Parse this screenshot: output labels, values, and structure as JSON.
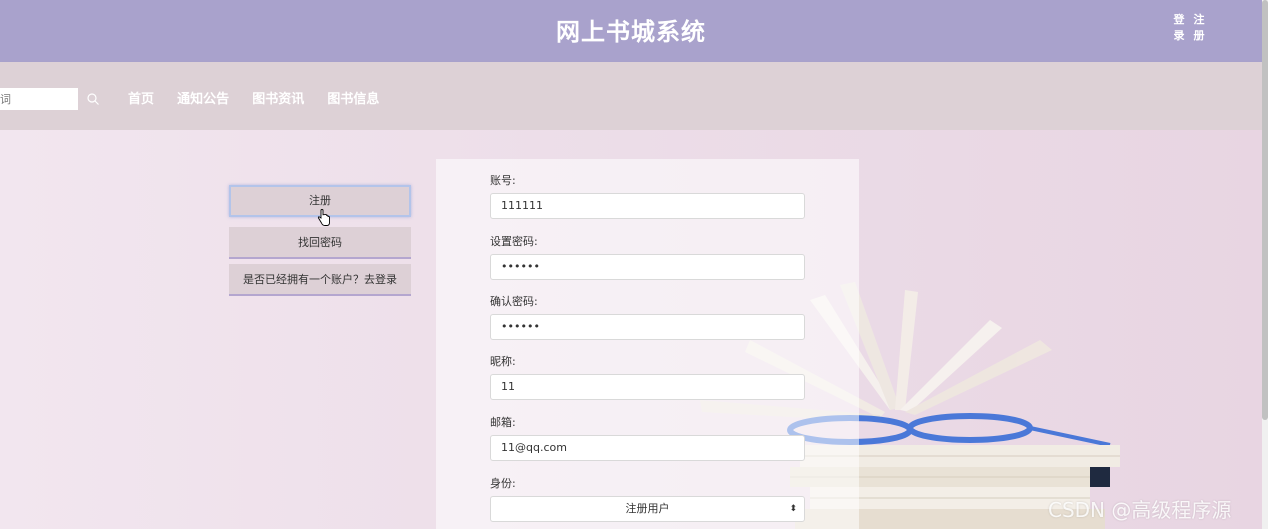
{
  "header": {
    "title": "网上书城系统",
    "login_link": [
      "登",
      "录"
    ],
    "register_link": [
      "注",
      "册"
    ]
  },
  "nav": {
    "search_value": "词",
    "links": [
      "首页",
      "通知公告",
      "图书资讯",
      "图书信息"
    ]
  },
  "side_buttons": {
    "register": "注册",
    "find_password": "找回密码",
    "go_login": "是否已经拥有一个账户？去登录"
  },
  "form": {
    "account_label": "账号:",
    "account_value": "111111",
    "password_label": "设置密码:",
    "password_value": "••••••",
    "confirm_label": "确认密码:",
    "confirm_value": "••••••",
    "nickname_label": "昵称:",
    "nickname_value": "11",
    "email_label": "邮箱:",
    "email_value": "11@qq.com",
    "role_label": "身份:",
    "role_value": "注册用户"
  },
  "watermark": "CSDN @高级程序源",
  "colors": {
    "header_bg": "#a9a2cc",
    "nav_bg": "#ddd1d6",
    "button_bg": "#ddd0d6"
  }
}
